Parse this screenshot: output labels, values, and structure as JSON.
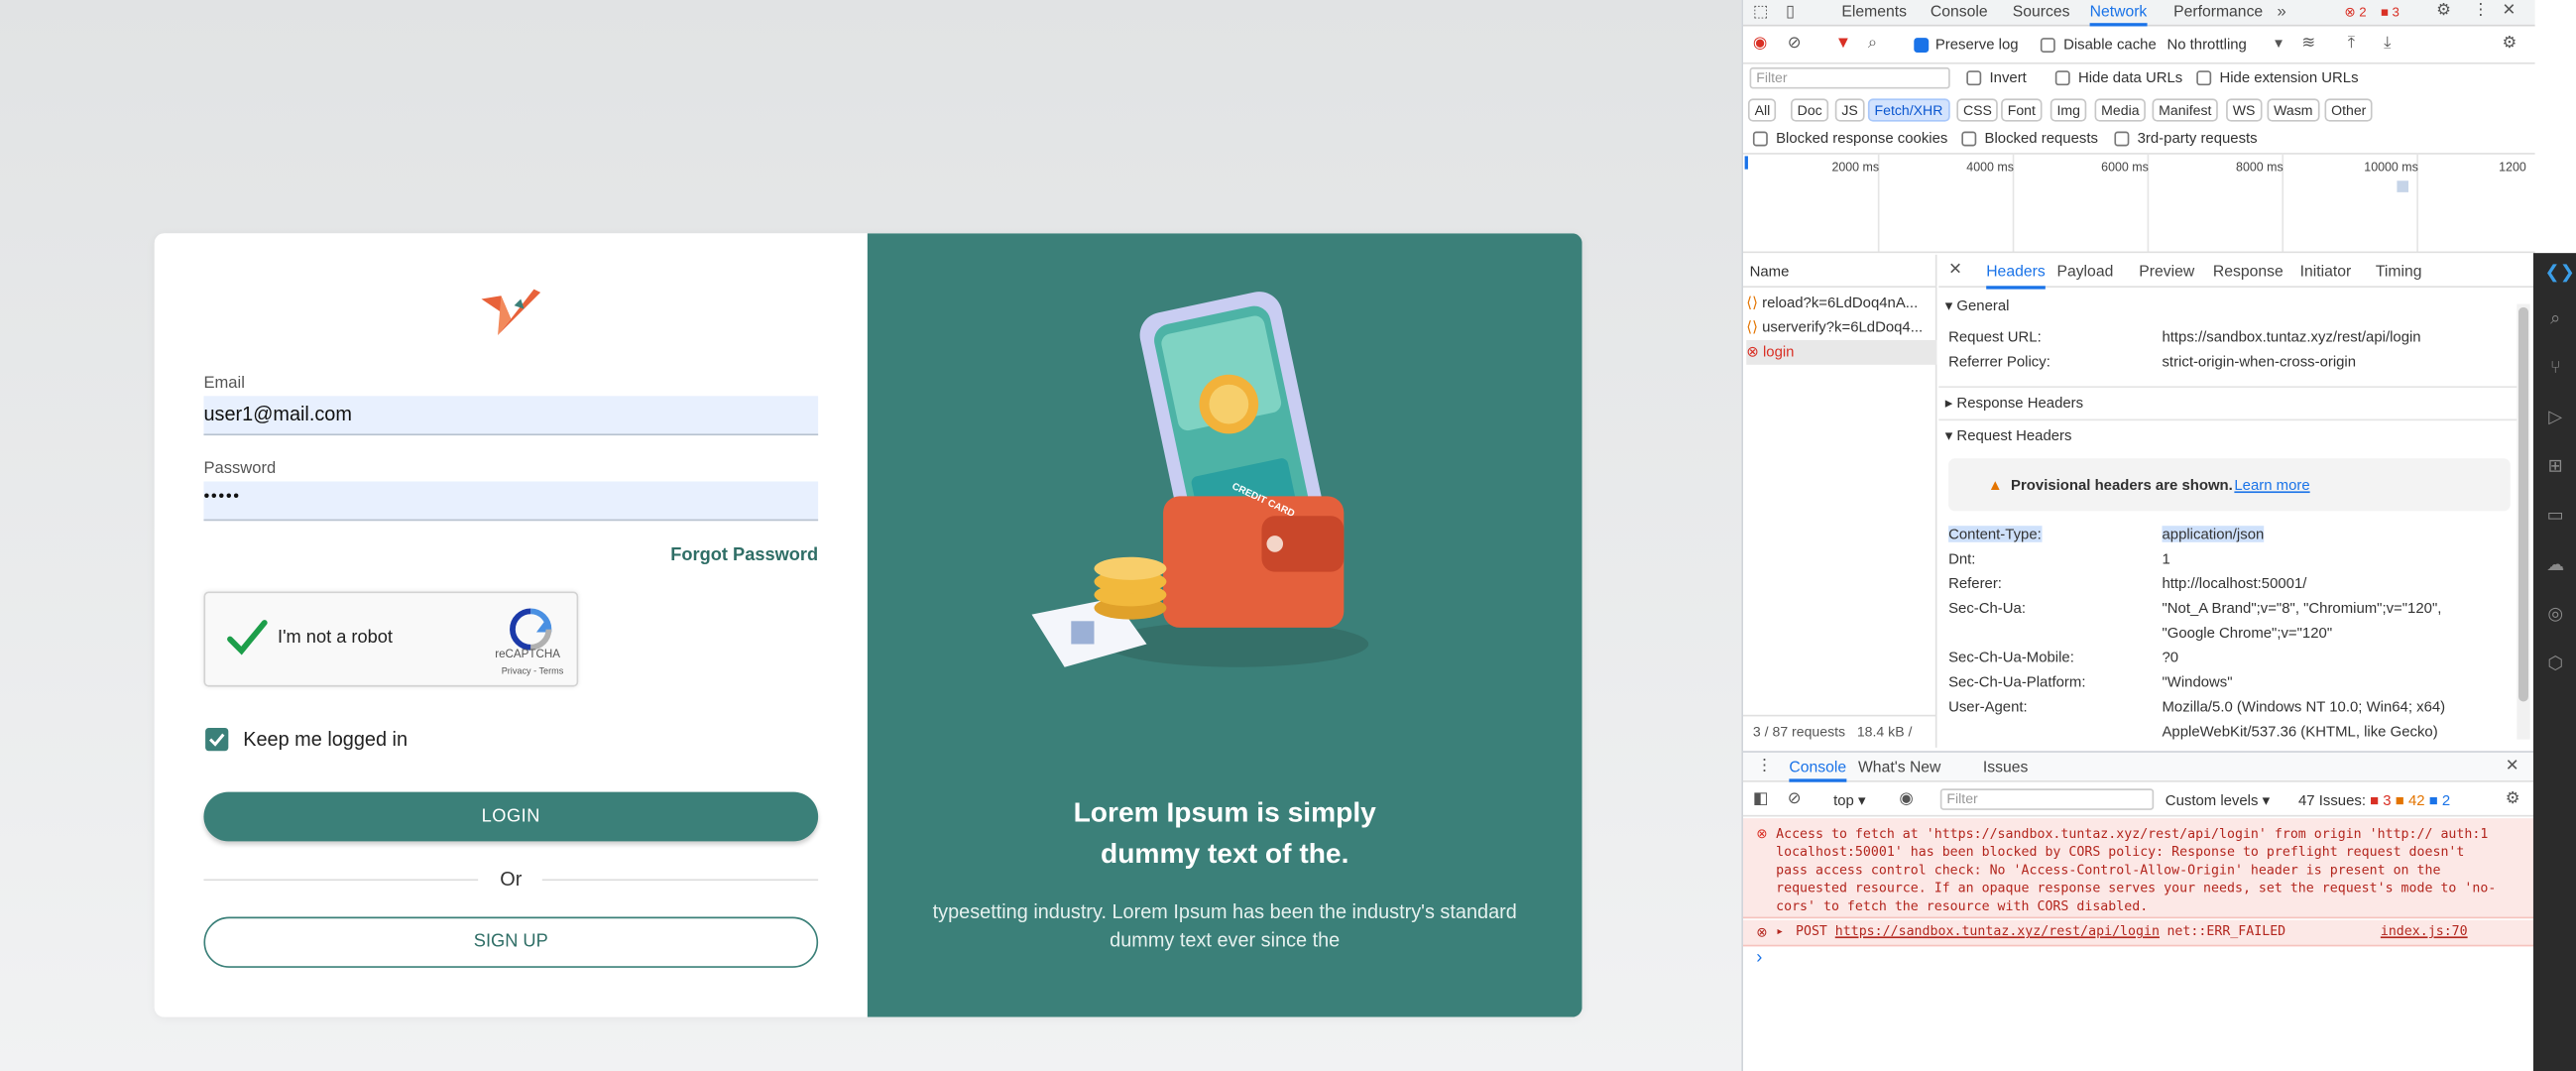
{
  "login": {
    "email_label": "Email",
    "email_value": "user1@mail.com",
    "password_label": "Password",
    "password_value": "•••••",
    "forgot": "Forgot Password",
    "captcha_text": "I'm not a robot",
    "captcha_brand": "reCAPTCHA",
    "captcha_links": "Privacy - Terms",
    "keep_logged": "Keep me logged in",
    "login_button": "LOGIN",
    "or": "Or",
    "signup_button": "SIGN UP"
  },
  "hero": {
    "title_line1": "Lorem Ipsum is simply",
    "title_line2": "dummy text of the.",
    "text_line1": "typesetting industry. Lorem Ipsum has been the industry's standard",
    "text_line2": "dummy text ever since the",
    "card_text": "CREDIT CARD"
  },
  "devtools": {
    "tabs": [
      "Elements",
      "Console",
      "Sources",
      "Network",
      "Performance"
    ],
    "error_count": "2",
    "warning_count": "3",
    "preserve_log": "Preserve log",
    "disable_cache": "Disable cache",
    "throttling": "No throttling",
    "filter_placeholder": "Filter",
    "invert": "Invert",
    "hide_data_urls": "Hide data URLs",
    "hide_ext_urls": "Hide extension URLs",
    "type_filters": [
      "All",
      "Doc",
      "JS",
      "Fetch/XHR",
      "CSS",
      "Font",
      "Img",
      "Media",
      "Manifest",
      "WS",
      "Wasm",
      "Other"
    ],
    "blocked_cookies": "Blocked response cookies",
    "blocked_requests": "Blocked requests",
    "third_party": "3rd-party requests",
    "timeline_ticks": [
      "2000 ms",
      "4000 ms",
      "6000 ms",
      "8000 ms",
      "10000 ms",
      "1200"
    ],
    "name_header": "Name",
    "requests": [
      "reload?k=6LdDoq4nA...",
      "userverify?k=6LdDoq4...",
      "login"
    ],
    "status_requests": "3 / 87 requests",
    "status_size": "18.4 kB /",
    "detail_tabs": [
      "Headers",
      "Payload",
      "Preview",
      "Response",
      "Initiator",
      "Timing"
    ],
    "general": "General",
    "request_url_key": "Request URL:",
    "request_url_val": "https://sandbox.tuntaz.xyz/rest/api/login",
    "referrer_policy_key": "Referrer Policy:",
    "referrer_policy_val": "strict-origin-when-cross-origin",
    "response_headers": "Response Headers",
    "request_headers": "Request Headers",
    "provisional": "Provisional headers are shown.",
    "learn_more": "Learn more",
    "headers": [
      {
        "k": "Content-Type:",
        "v": "application/json"
      },
      {
        "k": "Dnt:",
        "v": "1"
      },
      {
        "k": "Referer:",
        "v": "http://localhost:50001/"
      },
      {
        "k": "Sec-Ch-Ua:",
        "v": "\"Not_A Brand\";v=\"8\", \"Chromium\";v=\"120\","
      },
      {
        "k": "",
        "v": "\"Google Chrome\";v=\"120\""
      },
      {
        "k": "Sec-Ch-Ua-Mobile:",
        "v": "?0"
      },
      {
        "k": "Sec-Ch-Ua-Platform:",
        "v": "\"Windows\""
      },
      {
        "k": "User-Agent:",
        "v": "Mozilla/5.0 (Windows NT 10.0; Win64; x64)"
      },
      {
        "k": "",
        "v": "AppleWebKit/537.36 (KHTML, like Gecko)"
      }
    ],
    "drawer_tabs": [
      "Console",
      "What's New",
      "Issues"
    ],
    "context": "top",
    "console_filter": "Filter",
    "custom_levels": "Custom levels",
    "issues_label": "47 Issues:",
    "issues_err": "3",
    "issues_warn": "42",
    "issues_info": "2",
    "error1_lines": [
      "Access to fetch at 'https://sandbox.tuntaz.xyz/rest/api/login' from origin 'http:// auth:1",
      "localhost:50001' has been blocked by CORS policy: Response to preflight request doesn't",
      "pass access control check: No 'Access-Control-Allow-Origin' header is present on the",
      "requested resource. If an opaque response serves your needs, set the request's mode to 'no-",
      "cors' to fetch the resource with CORS disabled."
    ],
    "error2_method": "POST",
    "error2_url": "https://sandbox.tuntaz.xyz/rest/api/login",
    "error2_status": "net::ERR_FAILED",
    "error2_src": "index.js:70",
    "prompt": "›"
  }
}
